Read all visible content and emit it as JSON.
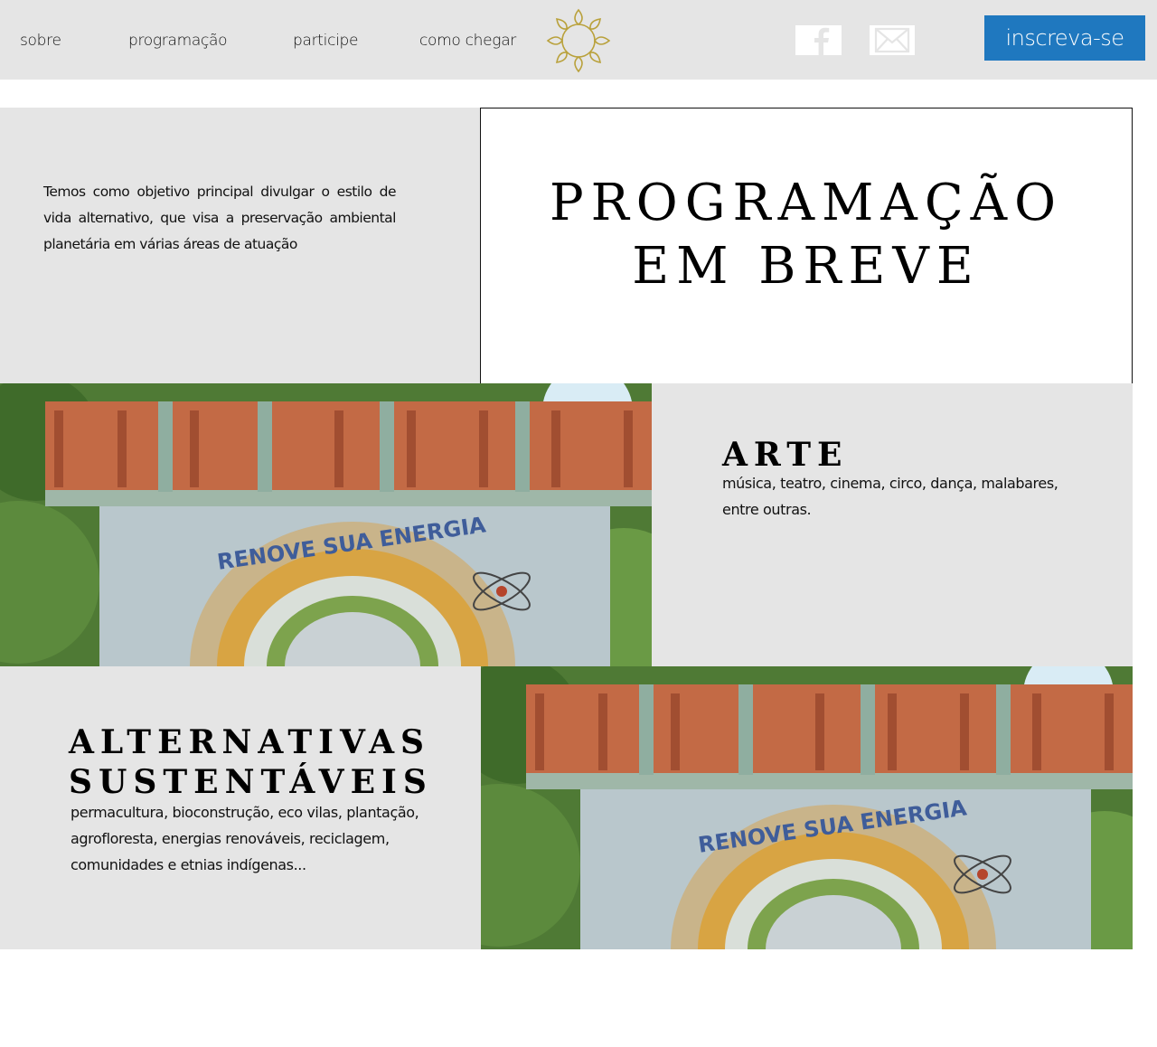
{
  "nav": {
    "items": [
      {
        "label": "sobre"
      },
      {
        "label": "programação"
      },
      {
        "label": "participe"
      },
      {
        "label": "como chegar"
      }
    ],
    "cta_label": "inscreva-se",
    "cta_color": "#1f78bf"
  },
  "icons": {
    "logo": "lotus-mandala-icon",
    "facebook": "facebook-icon",
    "email": "envelope-icon"
  },
  "intro": {
    "text": "Temos como objetivo principal divulgar o estilo de vida alternativo, que visa a preservação ambiental planetária em várias áreas de atuação"
  },
  "headline": {
    "line1": "PROGRAMAÇÃO",
    "line2": "EM BREVE"
  },
  "sections": [
    {
      "title": "ARTE",
      "description": "música, teatro, cinema, circo, dança, malabares, entre outras."
    },
    {
      "title_line1": "ALTERNATIVAS",
      "title_line2": "SUSTENTÁVEIS",
      "description": "permacultura, bioconstrução, eco vilas, plantação, agrofloresta, energias renováveis, reciclagem, comunidades e etnias indígenas..."
    }
  ],
  "photo": {
    "mural_text": "RENOVE SUA ENERGIA"
  },
  "colors": {
    "panel_gray": "#e5e5e5",
    "accent_gold": "#b9a13b"
  }
}
